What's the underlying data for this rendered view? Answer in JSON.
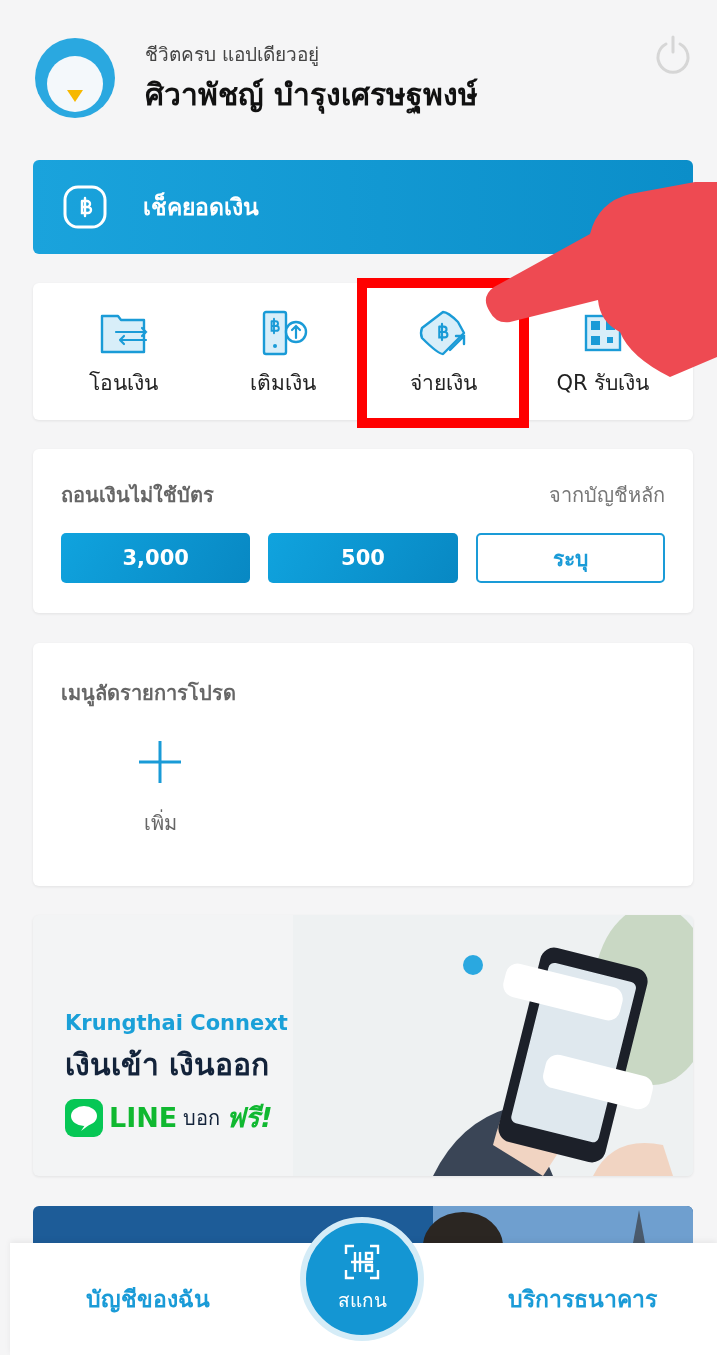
{
  "header": {
    "tagline": "ชีวิตครบ แอปเดียวอยู่",
    "user_name": "ศิวาพัชญ์ บำรุงเศรษฐพงษ์"
  },
  "balance_button": {
    "label": "เช็คยอดเงิน"
  },
  "quick_actions": [
    {
      "kind": "transfer",
      "label": "โอนเงิน",
      "highlighted": false
    },
    {
      "kind": "topup",
      "label": "เติมเงิน",
      "highlighted": false
    },
    {
      "kind": "pay",
      "label": "จ่ายเงิน",
      "highlighted": true
    },
    {
      "kind": "qr",
      "label": "QR รับเงิน",
      "highlighted": false
    }
  ],
  "cardless_withdrawal": {
    "title": "ถอนเงินไม่ใช้บัตร",
    "source": "จากบัญชีหลัก",
    "amounts": [
      {
        "label": "3,000",
        "kind": "filled"
      },
      {
        "label": "500",
        "kind": "filled"
      },
      {
        "label": "ระบุ",
        "kind": "outline"
      }
    ]
  },
  "favorites": {
    "title": "เมนูลัดรายการโปรด",
    "add_label": "เพิ่ม"
  },
  "promo_banner": {
    "brand": "Krungthai Connext",
    "headline": "เงินเข้า เงินออก",
    "line_label": "LINE",
    "message": "บอก",
    "free_label": "ฟรี!"
  },
  "bottom_nav": {
    "left": "บัญชีของฉัน",
    "scan": "สแกน",
    "right": "บริการธนาคาร"
  }
}
